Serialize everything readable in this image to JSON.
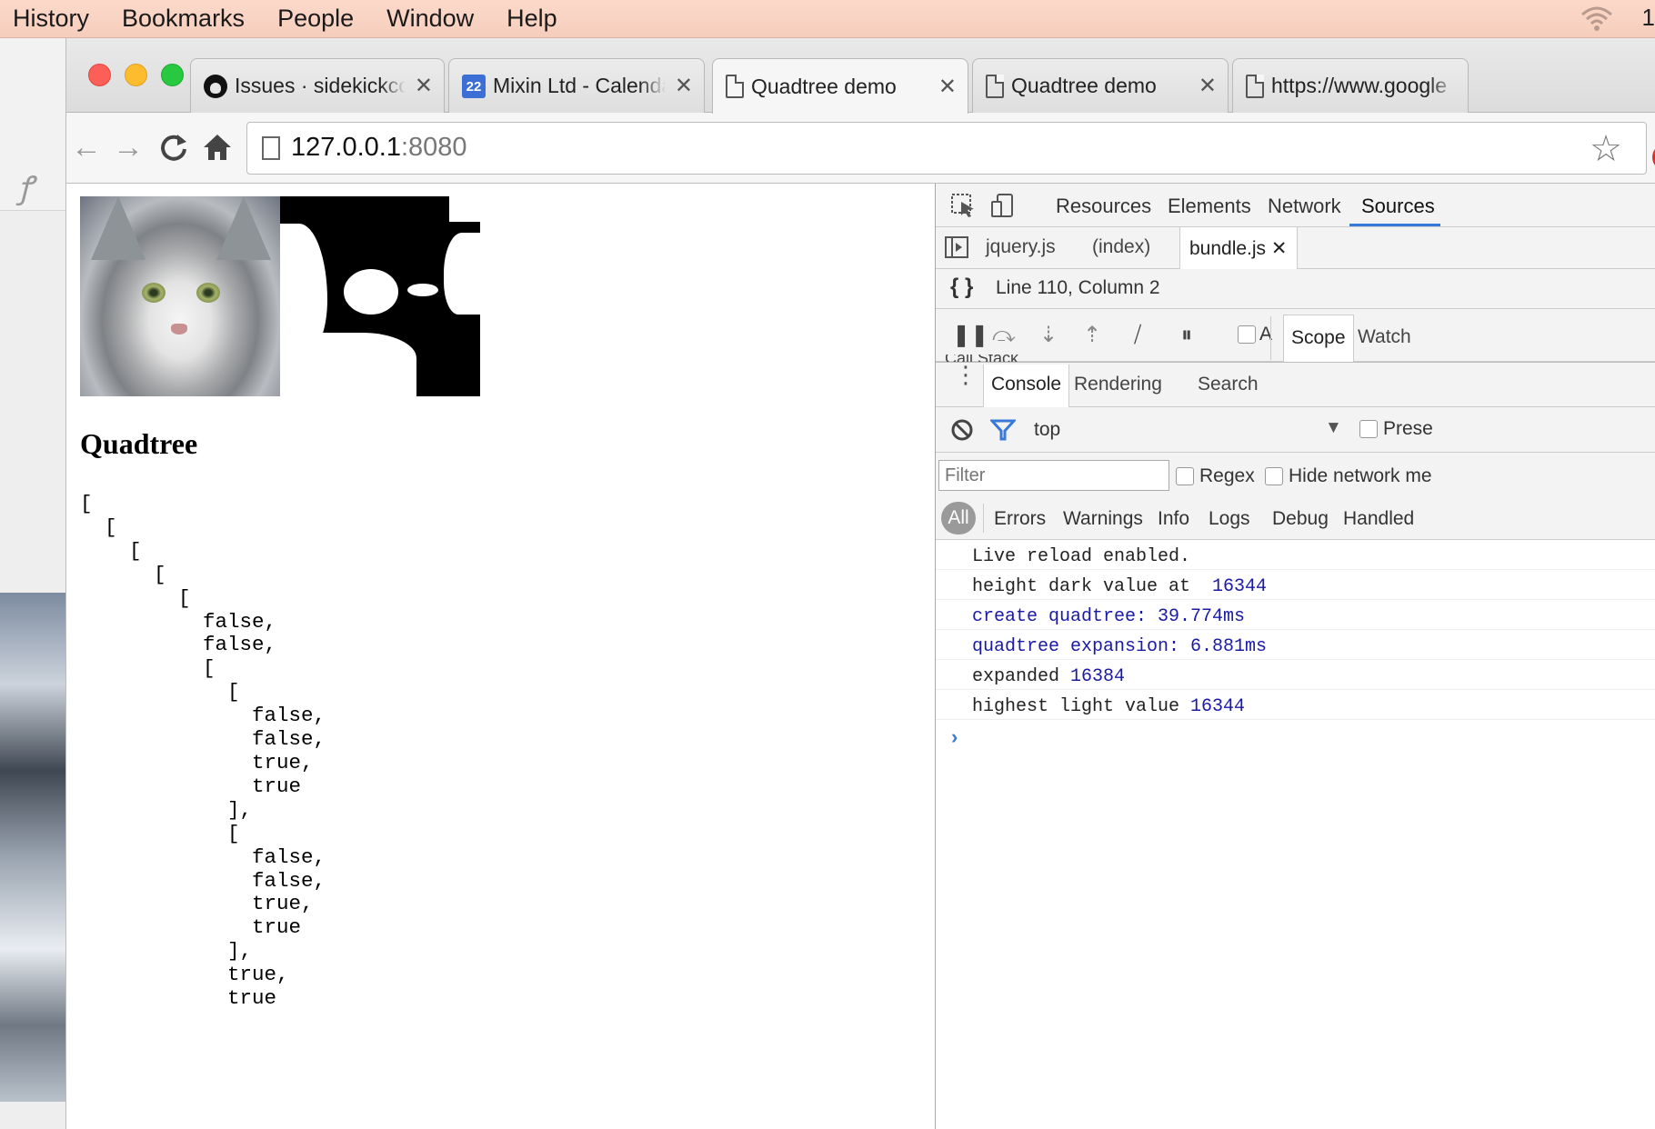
{
  "menubar": {
    "items": [
      "History",
      "Bookmarks",
      "People",
      "Window",
      "Help"
    ],
    "right_clip": "1"
  },
  "tabs": [
    {
      "title": "Issues · sidekickcode",
      "close": "✕",
      "icon": "github-icon",
      "active": false
    },
    {
      "title": "Mixin Ltd - Calendar",
      "close": "✕",
      "icon": "calendar-icon",
      "icon_text": "22",
      "active": false
    },
    {
      "title": "Quadtree demo",
      "close": "✕",
      "icon": "document-icon",
      "active": true
    },
    {
      "title": "Quadtree demo",
      "close": "✕",
      "icon": "document-icon",
      "active": false
    },
    {
      "title": "https://www.google",
      "icon": "document-icon",
      "active": false
    }
  ],
  "address": {
    "host": "127.0.0.1",
    "port": ":8080"
  },
  "page": {
    "heading": "Quadtree",
    "output": "[\n  [\n    [\n      [\n        [\n          false,\n          false,\n          [\n            [\n              false,\n              false,\n              true,\n              true\n            ],\n            [\n              false,\n              false,\n              true,\n              true\n            ],\n            true,\n            true"
  },
  "devtools": {
    "panels": [
      "Resources",
      "Elements",
      "Network",
      "Sources"
    ],
    "active_panel": "Sources",
    "files": [
      "jquery.js",
      "(index)",
      "bundle.js"
    ],
    "active_file": "bundle.js",
    "file_close": "✕",
    "position": "Line 110, Column 2",
    "debugger_checkbox_label": "A",
    "sidebar_tabs": {
      "scope": "Scope",
      "watch": "Watch"
    },
    "call_stack": "Call Stack",
    "drawer_tabs": [
      "Console",
      "Rendering",
      "Search"
    ],
    "active_drawer_tab": "Console",
    "context": "top",
    "preserve_label": "Prese",
    "filter_placeholder": "Filter",
    "regex_label": "Regex",
    "hide_network_label": "Hide network me",
    "levels": [
      "All",
      "Errors",
      "Warnings",
      "Info",
      "Logs",
      "Debug",
      "Handled"
    ],
    "console_lines": [
      {
        "text": "Live reload enabled.",
        "value": "",
        "style": "log"
      },
      {
        "text": "height dark value at  ",
        "value": "16344",
        "style": "log"
      },
      {
        "text": "create quadtree: 39.774ms",
        "value": "",
        "style": "timer"
      },
      {
        "text": "quadtree expansion: 6.881ms",
        "value": "",
        "style": "timer"
      },
      {
        "text": "expanded ",
        "value": "16384",
        "style": "log"
      },
      {
        "text": "highest light value ",
        "value": "16344",
        "style": "log"
      }
    ],
    "prompt": "›"
  }
}
